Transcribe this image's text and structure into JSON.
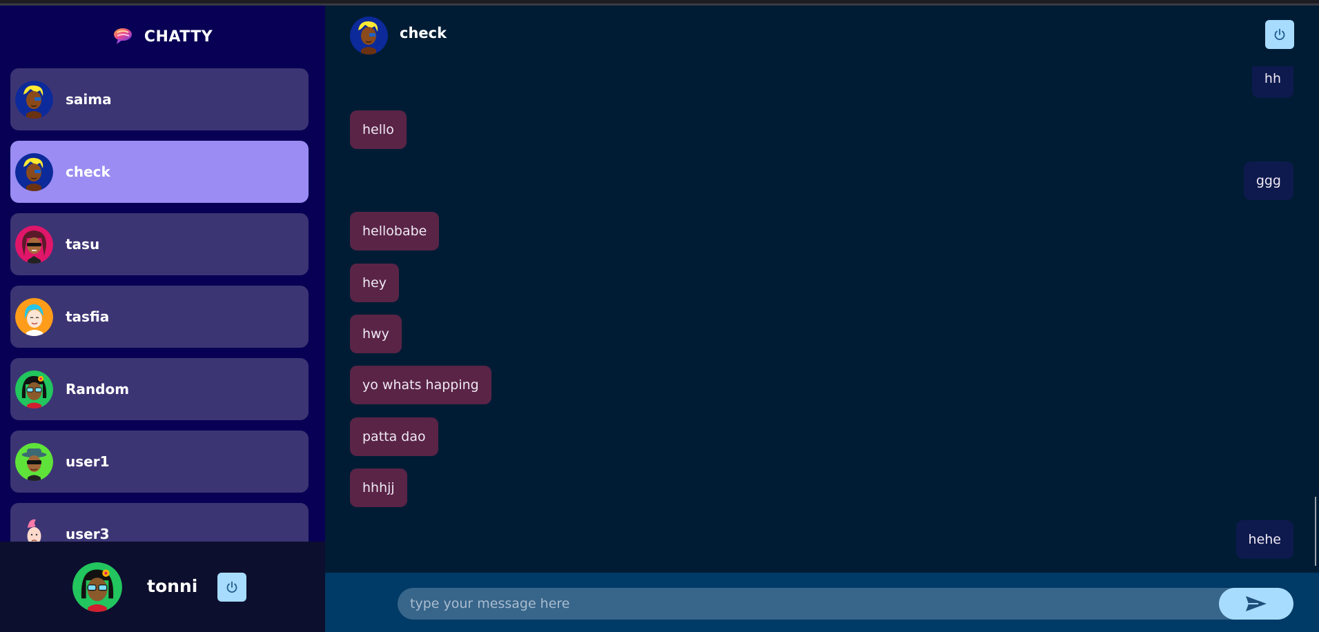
{
  "app": {
    "name": "CHATTY"
  },
  "contacts": [
    {
      "name": "saima",
      "avatar": "blonde-avatar",
      "active": false
    },
    {
      "name": "check",
      "avatar": "blonde-avatar",
      "active": true
    },
    {
      "name": "tasu",
      "avatar": "dreadlocks-sunglasses-avatar",
      "active": false
    },
    {
      "name": "tasfia",
      "avatar": "smiling-girl-avatar",
      "active": false
    },
    {
      "name": "Random",
      "avatar": "flower-sunglasses-avatar",
      "active": false
    },
    {
      "name": "user1",
      "avatar": "hat-sunglasses-avatar",
      "active": false
    },
    {
      "name": "user3",
      "avatar": "pink-hair-avatar",
      "active": false
    }
  ],
  "profile": {
    "name": "tonni",
    "avatar": "flower-sunglasses-avatar",
    "logout_icon": "power-icon"
  },
  "chat": {
    "title": "check",
    "avatar": "blonde-avatar",
    "logout_icon": "power-icon",
    "messages": [
      {
        "text": "hh",
        "dir": "out"
      },
      {
        "text": "hello",
        "dir": "in"
      },
      {
        "text": "ggg",
        "dir": "out"
      },
      {
        "text": "hellobabe",
        "dir": "in"
      },
      {
        "text": "hey",
        "dir": "in"
      },
      {
        "text": "hwy",
        "dir": "in"
      },
      {
        "text": "yo whats happing",
        "dir": "in"
      },
      {
        "text": "patta dao",
        "dir": "in"
      },
      {
        "text": "hhhjj",
        "dir": "in"
      },
      {
        "text": "hehe",
        "dir": "out"
      }
    ]
  },
  "composer": {
    "placeholder": "type your message here",
    "send_icon": "send-icon"
  },
  "colors": {
    "sidebar_bg": "#080054",
    "contact_bg": "#3c3574",
    "contact_active_bg": "#9a8cf2",
    "chat_bg": "#001c34",
    "incoming_bubble": "#5a2447",
    "outgoing_bubble": "#0e1a4e",
    "accent_button": "#a7dcff"
  }
}
